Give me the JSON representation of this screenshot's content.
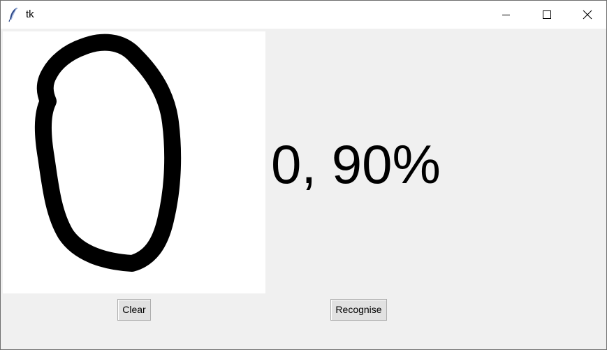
{
  "window": {
    "title": "tk",
    "controls": {
      "minimize": "minimize-icon",
      "maximize": "maximize-icon",
      "close": "close-icon"
    }
  },
  "canvas": {
    "drawing": "handwritten digit zero stroke",
    "background": "#ffffff",
    "stroke_color": "#000000"
  },
  "prediction": {
    "text": "0, 90%"
  },
  "buttons": {
    "clear_label": "Clear",
    "recognise_label": "Recognise"
  },
  "colors": {
    "window_bg": "#f0f0f0",
    "titlebar_bg": "#ffffff",
    "button_bg": "#e1e1e1"
  }
}
